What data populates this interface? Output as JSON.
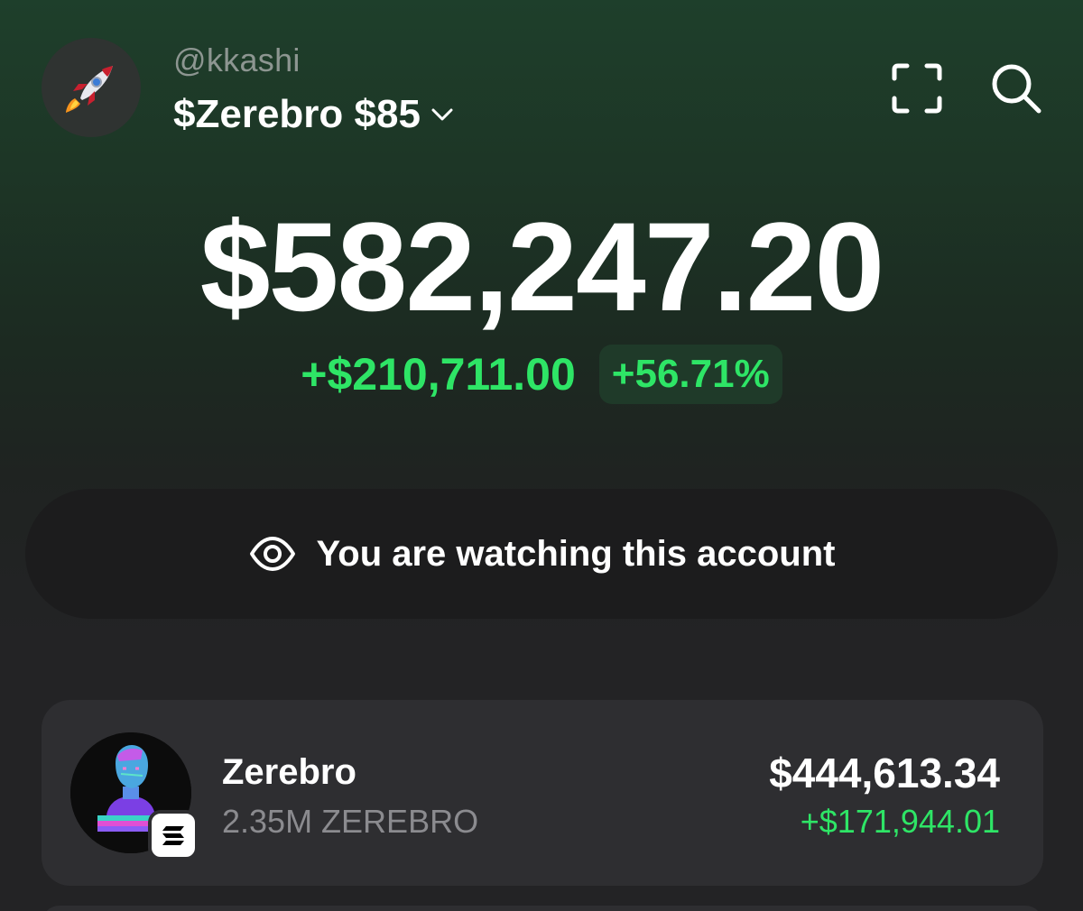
{
  "header": {
    "handle": "@kkashi",
    "wallet_name": "$Zerebro $85",
    "avatar_icon": "rocket-emoji",
    "scan_icon": "scan-frame-icon",
    "search_icon": "search-icon"
  },
  "balance": {
    "total": "$582,247.20",
    "change_amount": "+$210,711.00",
    "change_percent": "+56.71%"
  },
  "watching_banner": {
    "icon": "eye-icon",
    "text": "You are watching this account"
  },
  "tokens": [
    {
      "name": "Zerebro",
      "amount": "2.35M ZEREBRO",
      "value": "$444,613.34",
      "change": "+$171,944.01",
      "chain_icon": "solana-icon"
    }
  ],
  "colors": {
    "positive": "#2ee566",
    "background": "#232325",
    "card": "#2e2e31",
    "header_gradient_top": "#1e3f2b"
  }
}
